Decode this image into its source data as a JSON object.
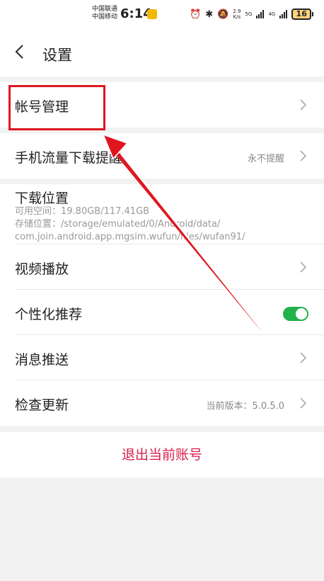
{
  "status_bar": {
    "carrier_1": "中国联通",
    "carrier_2": "中国移动",
    "time": "6:14",
    "net_speed_value": "2.9",
    "net_speed_unit": "K/s",
    "sig1_label": "5G",
    "sig2_label": "4G",
    "battery": "16",
    "icons": [
      "alarm-icon",
      "bluetooth-icon",
      "mute-icon",
      "signal-icon",
      "battery-icon"
    ]
  },
  "header": {
    "title": "设置"
  },
  "settings": {
    "account": {
      "label": "帐号管理"
    },
    "mobile_data": {
      "label": "手机流量下载提醒",
      "value": "永不提醒"
    },
    "download": {
      "label": "下载位置",
      "space": "可用空间：19.80GB/117.41GB",
      "path_1": "存储位置：/storage/emulated/0/Android/data/",
      "path_2": "com.join.android.app.mgsim.wufun/files/wufan91/"
    },
    "video": {
      "label": "视频播放"
    },
    "personalized": {
      "label": "个性化推荐",
      "enabled": true
    },
    "push": {
      "label": "消息推送"
    },
    "update": {
      "label": "检查更新",
      "value": "当前版本：5.0.5.0"
    }
  },
  "logout": {
    "label": "退出当前账号"
  },
  "colors": {
    "accent_red": "#d81e4c",
    "toggle_green": "#22b14c",
    "annotation_red": "#e0161f"
  }
}
